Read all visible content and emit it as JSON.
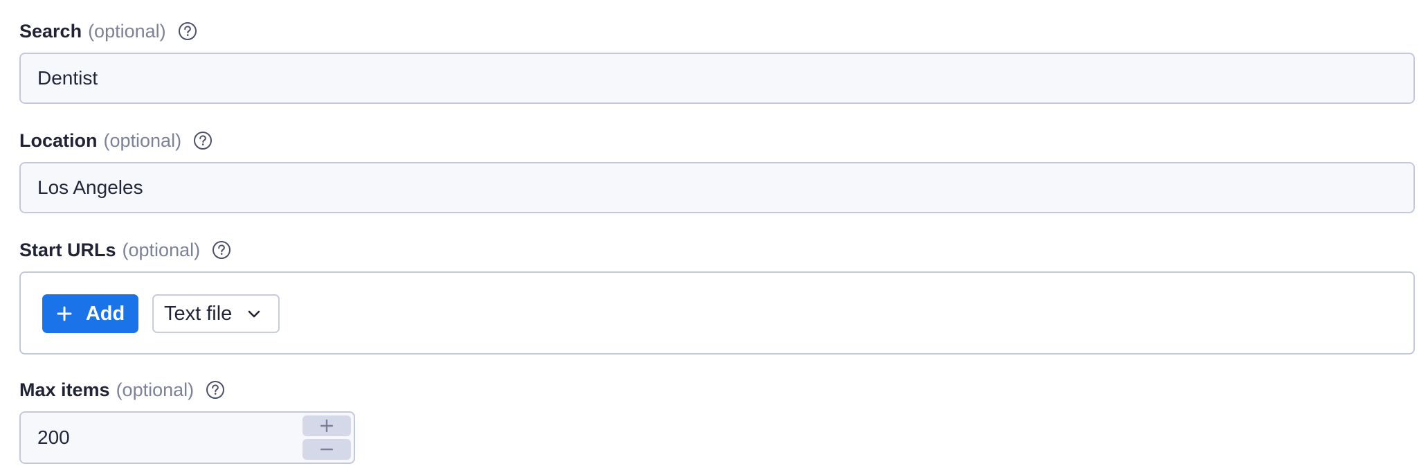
{
  "fields": {
    "search": {
      "label": "Search",
      "optional": "(optional)",
      "value": "Dentist"
    },
    "location": {
      "label": "Location",
      "optional": "(optional)",
      "value": "Los Angeles"
    },
    "start_urls": {
      "label": "Start URLs",
      "optional": "(optional)",
      "add_label": "Add",
      "source_select": "Text file"
    },
    "max_items": {
      "label": "Max items",
      "optional": "(optional)",
      "value": "200"
    }
  },
  "icons": {
    "help": "help-circle-icon",
    "add": "plus-icon",
    "dropdown": "chevron-down-icon",
    "increment": "plus-icon",
    "decrement": "minus-icon"
  },
  "colors": {
    "primary": "#1a73e8",
    "input_bg": "#f7f8fc",
    "input_border": "#c3c8dc",
    "muted_text": "#7b8296",
    "stepper_bg": "#d5d8e8"
  }
}
